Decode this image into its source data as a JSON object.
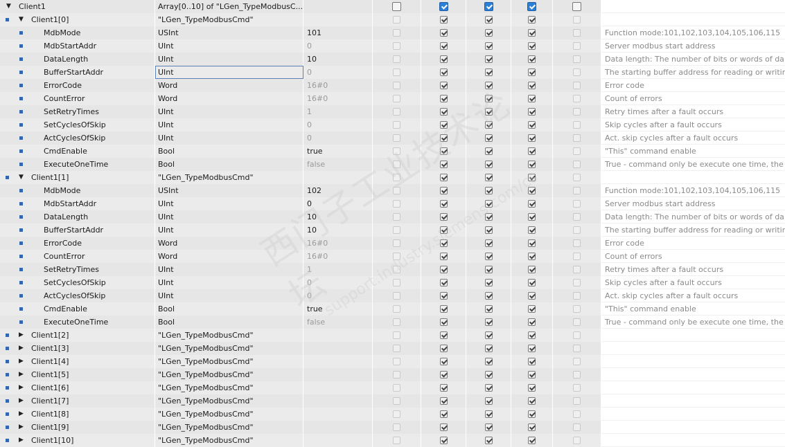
{
  "columns": [
    {
      "key": "name"
    },
    {
      "key": "type"
    },
    {
      "key": "start"
    },
    {
      "key": "chk1"
    },
    {
      "key": "chk2"
    },
    {
      "key": "chk3"
    },
    {
      "key": "chk4"
    },
    {
      "key": "chk5"
    },
    {
      "key": "comment"
    }
  ],
  "accent_color": "#3267b4",
  "rows": [
    {
      "name": "Client1",
      "type": "Array[0..10] of \"LGen_TypeModbusC...",
      "start": "",
      "level": 0,
      "expander": "open",
      "bullet": false,
      "checks": [
        false,
        true,
        true,
        true,
        false
      ],
      "checks_style": "header",
      "comment": ""
    },
    {
      "name": "Client1[0]",
      "type": "\"LGen_TypeModbusCmd\"",
      "start": "",
      "level": 1,
      "expander": "open",
      "bullet": true,
      "checks": [
        false,
        true,
        true,
        true,
        false
      ],
      "comment": ""
    },
    {
      "name": "MdbMode",
      "type": "USInt",
      "start": "101",
      "start_dim": false,
      "level": 2,
      "bullet": true,
      "checks": [
        false,
        true,
        true,
        true,
        false
      ],
      "comment": "Function mode:101,102,103,104,105,106,115"
    },
    {
      "name": "MdbStartAddr",
      "type": "UInt",
      "start": "0",
      "start_dim": true,
      "level": 2,
      "bullet": true,
      "checks": [
        false,
        true,
        true,
        true,
        false
      ],
      "comment": "Server modbus start address"
    },
    {
      "name": "DataLength",
      "type": "UInt",
      "start": "10",
      "start_dim": false,
      "level": 2,
      "bullet": true,
      "checks": [
        false,
        true,
        true,
        true,
        false
      ],
      "comment": "Data length: The number of bits or words of da"
    },
    {
      "name": "BufferStartAddr",
      "type": "UInt",
      "start": "0",
      "start_dim": true,
      "level": 2,
      "bullet": true,
      "edit": true,
      "checks": [
        false,
        true,
        true,
        true,
        false
      ],
      "comment": "The starting buffer address for reading or writin"
    },
    {
      "name": "ErrorCode",
      "type": "Word",
      "start": "16#0",
      "start_dim": true,
      "level": 2,
      "bullet": true,
      "checks": [
        false,
        true,
        true,
        true,
        false
      ],
      "comment": "Error code"
    },
    {
      "name": "CountError",
      "type": "Word",
      "start": "16#0",
      "start_dim": true,
      "level": 2,
      "bullet": true,
      "checks": [
        false,
        true,
        true,
        true,
        false
      ],
      "comment": "Count of errors"
    },
    {
      "name": "SetRetryTimes",
      "type": "UInt",
      "start": "1",
      "start_dim": true,
      "level": 2,
      "bullet": true,
      "checks": [
        false,
        true,
        true,
        true,
        false
      ],
      "comment": "Retry times after a fault occurs"
    },
    {
      "name": "SetCyclesOfSkip",
      "type": "UInt",
      "start": "0",
      "start_dim": true,
      "level": 2,
      "bullet": true,
      "checks": [
        false,
        true,
        true,
        true,
        false
      ],
      "comment": "Skip cycles after a fault occurs"
    },
    {
      "name": "ActCyclesOfSkip",
      "type": "UInt",
      "start": "0",
      "start_dim": true,
      "level": 2,
      "bullet": true,
      "checks": [
        false,
        true,
        true,
        true,
        false
      ],
      "comment": "Act. skip cycles after a fault occurs"
    },
    {
      "name": "CmdEnable",
      "type": "Bool",
      "start": "true",
      "start_dim": false,
      "level": 2,
      "bullet": true,
      "checks": [
        false,
        true,
        true,
        true,
        false
      ],
      "comment": "\"This\" command enable"
    },
    {
      "name": "ExecuteOneTime",
      "type": "Bool",
      "start": "false",
      "start_dim": true,
      "level": 2,
      "bullet": true,
      "checks": [
        false,
        true,
        true,
        true,
        false
      ],
      "comment": "True - command only be execute one time, the"
    },
    {
      "name": "Client1[1]",
      "type": "\"LGen_TypeModbusCmd\"",
      "start": "",
      "level": 1,
      "expander": "open",
      "bullet": true,
      "checks": [
        false,
        true,
        true,
        true,
        false
      ],
      "comment": ""
    },
    {
      "name": "MdbMode",
      "type": "USInt",
      "start": "102",
      "start_dim": false,
      "level": 2,
      "bullet": true,
      "checks": [
        false,
        true,
        true,
        true,
        false
      ],
      "comment": "Function mode:101,102,103,104,105,106,115"
    },
    {
      "name": "MdbStartAddr",
      "type": "UInt",
      "start": "0",
      "start_dim": false,
      "level": 2,
      "bullet": true,
      "checks": [
        false,
        true,
        true,
        true,
        false
      ],
      "comment": "Server modbus start address"
    },
    {
      "name": "DataLength",
      "type": "UInt",
      "start": "10",
      "start_dim": false,
      "level": 2,
      "bullet": true,
      "checks": [
        false,
        true,
        true,
        true,
        false
      ],
      "comment": "Data length: The number of bits or words of da"
    },
    {
      "name": "BufferStartAddr",
      "type": "UInt",
      "start": "10",
      "start_dim": false,
      "level": 2,
      "bullet": true,
      "checks": [
        false,
        true,
        true,
        true,
        false
      ],
      "comment": "The starting buffer address for reading or writin"
    },
    {
      "name": "ErrorCode",
      "type": "Word",
      "start": "16#0",
      "start_dim": true,
      "level": 2,
      "bullet": true,
      "checks": [
        false,
        true,
        true,
        true,
        false
      ],
      "comment": "Error code"
    },
    {
      "name": "CountError",
      "type": "Word",
      "start": "16#0",
      "start_dim": true,
      "level": 2,
      "bullet": true,
      "checks": [
        false,
        true,
        true,
        true,
        false
      ],
      "comment": "Count of errors"
    },
    {
      "name": "SetRetryTimes",
      "type": "UInt",
      "start": "1",
      "start_dim": true,
      "level": 2,
      "bullet": true,
      "checks": [
        false,
        true,
        true,
        true,
        false
      ],
      "comment": "Retry times after a fault occurs"
    },
    {
      "name": "SetCyclesOfSkip",
      "type": "UInt",
      "start": "0",
      "start_dim": true,
      "level": 2,
      "bullet": true,
      "checks": [
        false,
        true,
        true,
        true,
        false
      ],
      "comment": "Skip cycles after a fault occurs"
    },
    {
      "name": "ActCyclesOfSkip",
      "type": "UInt",
      "start": "0",
      "start_dim": true,
      "level": 2,
      "bullet": true,
      "checks": [
        false,
        true,
        true,
        true,
        false
      ],
      "comment": "Act. skip cycles after a fault occurs"
    },
    {
      "name": "CmdEnable",
      "type": "Bool",
      "start": "true",
      "start_dim": false,
      "level": 2,
      "bullet": true,
      "checks": [
        false,
        true,
        true,
        true,
        false
      ],
      "comment": "\"This\" command enable"
    },
    {
      "name": "ExecuteOneTime",
      "type": "Bool",
      "start": "false",
      "start_dim": true,
      "level": 2,
      "bullet": true,
      "checks": [
        false,
        true,
        true,
        true,
        false
      ],
      "comment": "True - command only be execute one time, the"
    },
    {
      "name": "Client1[2]",
      "type": "\"LGen_TypeModbusCmd\"",
      "start": "",
      "level": 1,
      "expander": "closed",
      "bullet": true,
      "checks": [
        false,
        true,
        true,
        true,
        false
      ],
      "comment": ""
    },
    {
      "name": "Client1[3]",
      "type": "\"LGen_TypeModbusCmd\"",
      "start": "",
      "level": 1,
      "expander": "closed",
      "bullet": true,
      "checks": [
        false,
        true,
        true,
        true,
        false
      ],
      "comment": ""
    },
    {
      "name": "Client1[4]",
      "type": "\"LGen_TypeModbusCmd\"",
      "start": "",
      "level": 1,
      "expander": "closed",
      "bullet": true,
      "checks": [
        false,
        true,
        true,
        true,
        false
      ],
      "comment": ""
    },
    {
      "name": "Client1[5]",
      "type": "\"LGen_TypeModbusCmd\"",
      "start": "",
      "level": 1,
      "expander": "closed",
      "bullet": true,
      "checks": [
        false,
        true,
        true,
        true,
        false
      ],
      "comment": ""
    },
    {
      "name": "Client1[6]",
      "type": "\"LGen_TypeModbusCmd\"",
      "start": "",
      "level": 1,
      "expander": "closed",
      "bullet": true,
      "checks": [
        false,
        true,
        true,
        true,
        false
      ],
      "comment": ""
    },
    {
      "name": "Client1[7]",
      "type": "\"LGen_TypeModbusCmd\"",
      "start": "",
      "level": 1,
      "expander": "closed",
      "bullet": true,
      "checks": [
        false,
        true,
        true,
        true,
        false
      ],
      "comment": ""
    },
    {
      "name": "Client1[8]",
      "type": "\"LGen_TypeModbusCmd\"",
      "start": "",
      "level": 1,
      "expander": "closed",
      "bullet": true,
      "checks": [
        false,
        true,
        true,
        true,
        false
      ],
      "comment": ""
    },
    {
      "name": "Client1[9]",
      "type": "\"LGen_TypeModbusCmd\"",
      "start": "",
      "level": 1,
      "expander": "closed",
      "bullet": true,
      "checks": [
        false,
        true,
        true,
        true,
        false
      ],
      "comment": ""
    },
    {
      "name": "Client1[10]",
      "type": "\"LGen_TypeModbusCmd\"",
      "start": "",
      "level": 1,
      "expander": "closed",
      "bullet": true,
      "checks": [
        false,
        true,
        true,
        true,
        false
      ],
      "comment": ""
    }
  ],
  "watermark": {
    "line1": "西门子工业技术论坛",
    "line2": "support.industry.siemens.com/cs"
  }
}
